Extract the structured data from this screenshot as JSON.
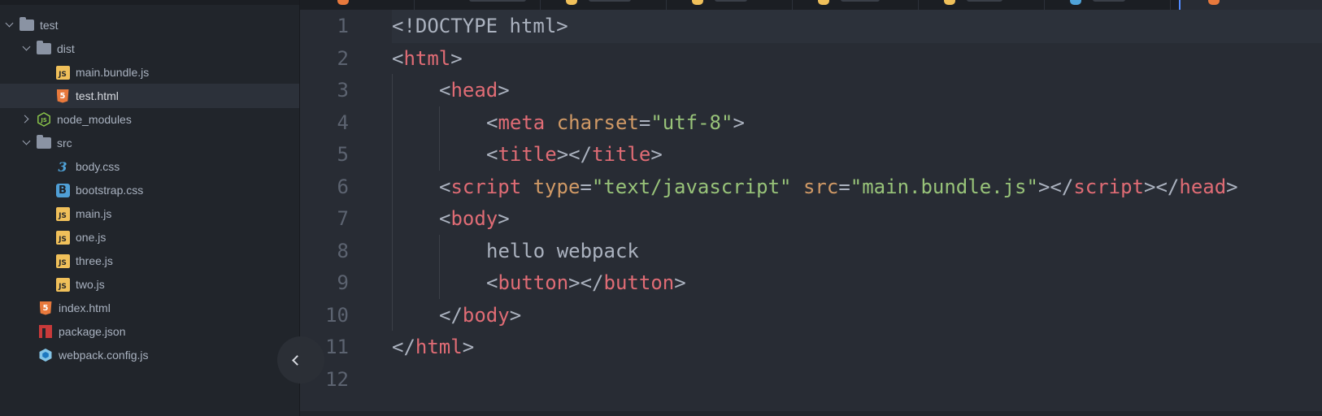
{
  "file_tree": {
    "items": [
      {
        "label": "test",
        "type": "folder",
        "expanded": true,
        "depth": 0,
        "icon": "folder-icon"
      },
      {
        "label": "dist",
        "type": "folder",
        "expanded": true,
        "depth": 1,
        "icon": "folder-icon"
      },
      {
        "label": "main.bundle.js",
        "type": "file",
        "depth": 2,
        "icon": "js-file-icon"
      },
      {
        "label": "test.html",
        "type": "file",
        "depth": 2,
        "icon": "html5-file-icon",
        "selected": true
      },
      {
        "label": "node_modules",
        "type": "folder",
        "expanded": false,
        "depth": 1,
        "icon": "nodejs-folder-icon"
      },
      {
        "label": "src",
        "type": "folder",
        "expanded": true,
        "depth": 1,
        "icon": "folder-icon"
      },
      {
        "label": "body.css",
        "type": "file",
        "depth": 2,
        "icon": "css3-file-icon"
      },
      {
        "label": "bootstrap.css",
        "type": "file",
        "depth": 2,
        "icon": "bootstrap-file-icon"
      },
      {
        "label": "main.js",
        "type": "file",
        "depth": 2,
        "icon": "js-file-icon"
      },
      {
        "label": "one.js",
        "type": "file",
        "depth": 2,
        "icon": "js-file-icon"
      },
      {
        "label": "three.js",
        "type": "file",
        "depth": 2,
        "icon": "js-file-icon"
      },
      {
        "label": "two.js",
        "type": "file",
        "depth": 2,
        "icon": "js-file-icon"
      },
      {
        "label": "index.html",
        "type": "file",
        "depth": 1,
        "icon": "html5-file-icon"
      },
      {
        "label": "package.json",
        "type": "file",
        "depth": 1,
        "icon": "npm-file-icon"
      },
      {
        "label": "webpack.config.js",
        "type": "file",
        "depth": 1,
        "icon": "webpack-file-icon"
      }
    ]
  },
  "editor": {
    "current_line": 1,
    "lines": [
      {
        "n": "1",
        "indent": 0,
        "tokens": [
          [
            "punc",
            "<!DOCTYPE html>"
          ]
        ]
      },
      {
        "n": "2",
        "indent": 0,
        "tokens": [
          [
            "punc",
            "<"
          ],
          [
            "tag",
            "html"
          ],
          [
            "punc",
            ">"
          ]
        ]
      },
      {
        "n": "3",
        "indent": 1,
        "tokens": [
          [
            "punc",
            "<"
          ],
          [
            "tag",
            "head"
          ],
          [
            "punc",
            ">"
          ]
        ]
      },
      {
        "n": "4",
        "indent": 2,
        "tokens": [
          [
            "punc",
            "<"
          ],
          [
            "tag",
            "meta"
          ],
          [
            "punc",
            " "
          ],
          [
            "attr",
            "charset"
          ],
          [
            "punc",
            "="
          ],
          [
            "str",
            "\"utf-8\""
          ],
          [
            "punc",
            ">"
          ]
        ]
      },
      {
        "n": "5",
        "indent": 2,
        "tokens": [
          [
            "punc",
            "<"
          ],
          [
            "tag",
            "title"
          ],
          [
            "punc",
            "></"
          ],
          [
            "tag",
            "title"
          ],
          [
            "punc",
            ">"
          ]
        ]
      },
      {
        "n": "6",
        "indent": 1,
        "tokens": [
          [
            "punc",
            "<"
          ],
          [
            "tag",
            "script"
          ],
          [
            "punc",
            " "
          ],
          [
            "attr",
            "type"
          ],
          [
            "punc",
            "="
          ],
          [
            "str",
            "\"text/javascript\""
          ],
          [
            "punc",
            " "
          ],
          [
            "attr",
            "src"
          ],
          [
            "punc",
            "="
          ],
          [
            "str",
            "\"main.bundle.js\""
          ],
          [
            "punc",
            "></"
          ],
          [
            "tag",
            "script"
          ],
          [
            "punc",
            "></"
          ],
          [
            "tag",
            "head"
          ],
          [
            "punc",
            ">"
          ]
        ]
      },
      {
        "n": "7",
        "indent": 1,
        "tokens": [
          [
            "punc",
            "<"
          ],
          [
            "tag",
            "body"
          ],
          [
            "punc",
            ">"
          ]
        ]
      },
      {
        "n": "8",
        "indent": 2,
        "tokens": [
          [
            "text",
            "hello webpack"
          ]
        ]
      },
      {
        "n": "9",
        "indent": 2,
        "tokens": [
          [
            "punc",
            "<"
          ],
          [
            "tag",
            "button"
          ],
          [
            "punc",
            "></"
          ],
          [
            "tag",
            "button"
          ],
          [
            "punc",
            ">"
          ]
        ]
      },
      {
        "n": "10",
        "indent": 1,
        "tokens": [
          [
            "punc",
            "</"
          ],
          [
            "tag",
            "body"
          ],
          [
            "punc",
            ">"
          ]
        ]
      },
      {
        "n": "11",
        "indent": 0,
        "tokens": [
          [
            "punc",
            "</"
          ],
          [
            "tag",
            "html"
          ],
          [
            "punc",
            ">"
          ]
        ]
      },
      {
        "n": "12",
        "indent": 0,
        "tokens": []
      }
    ]
  },
  "colors": {
    "tag": "#e06c75",
    "attr": "#d19a66",
    "string": "#98c379",
    "text": "#abb2bf",
    "line_number": "#5c6370",
    "editor_bg": "#282c34",
    "sidebar_bg": "#21252b",
    "selection_bg": "#2c313a",
    "tab_accent": "#528bff"
  }
}
